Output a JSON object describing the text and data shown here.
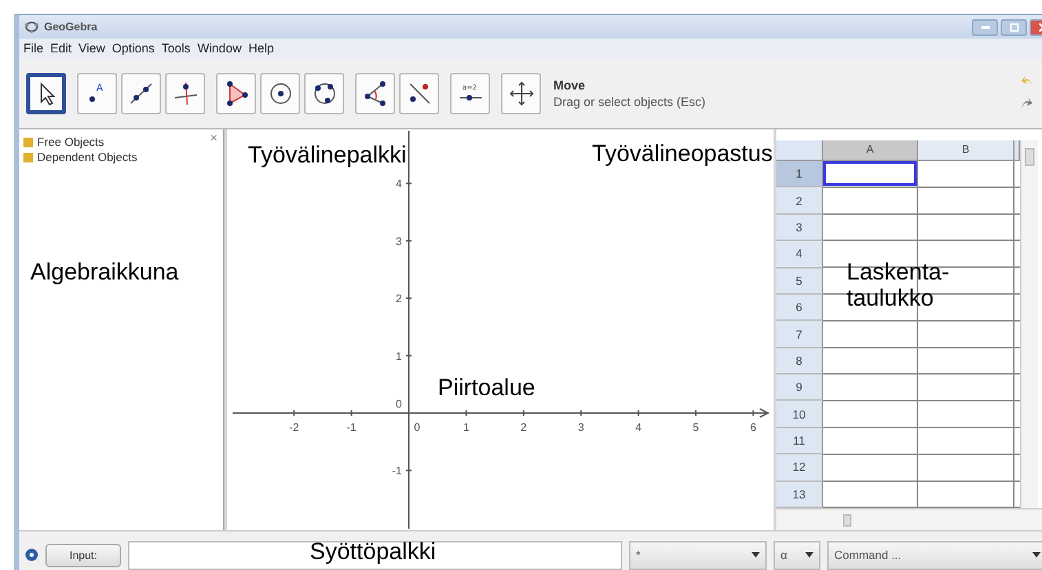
{
  "window": {
    "title": "GeoGebra"
  },
  "menu": [
    "File",
    "Edit",
    "View",
    "Options",
    "Tools",
    "Window",
    "Help"
  ],
  "toolbar": {
    "tools": [
      {
        "kind": "select",
        "selected": true
      },
      {
        "kind": "point",
        "selected": false,
        "icon_text": "A"
      },
      {
        "kind": "line",
        "selected": false
      },
      {
        "kind": "perpendicular",
        "selected": false
      },
      {
        "kind": "polygon",
        "selected": false
      },
      {
        "kind": "circle",
        "selected": false
      },
      {
        "kind": "conic",
        "selected": false
      },
      {
        "kind": "angle",
        "selected": false
      },
      {
        "kind": "reflect",
        "selected": false
      },
      {
        "kind": "slider",
        "selected": false,
        "icon_text": "a=2"
      },
      {
        "kind": "move-view",
        "selected": false
      }
    ],
    "tool_name": "Move",
    "tool_help": "Drag or select objects (Esc)"
  },
  "algebra_view": {
    "close": "×",
    "items": [
      "Free Objects",
      "Dependent Objects"
    ]
  },
  "graphics_view": {
    "x_ticks": [
      "-2",
      "-1",
      "0",
      "1",
      "2",
      "3",
      "4",
      "5",
      "6"
    ],
    "y_ticks": [
      "4",
      "3",
      "2",
      "1",
      "0",
      "-1"
    ]
  },
  "spreadsheet": {
    "columns": [
      {
        "label": "A",
        "selected": true
      },
      {
        "label": "B",
        "selected": false
      }
    ],
    "rows": [
      {
        "label": "1",
        "selected": true
      },
      {
        "label": "2",
        "selected": false
      },
      {
        "label": "3",
        "selected": false
      },
      {
        "label": "4",
        "selected": false
      },
      {
        "label": "5",
        "selected": false
      },
      {
        "label": "6",
        "selected": false
      },
      {
        "label": "7",
        "selected": false
      },
      {
        "label": "8",
        "selected": false
      },
      {
        "label": "9",
        "selected": false
      },
      {
        "label": "10",
        "selected": false
      },
      {
        "label": "11",
        "selected": false
      },
      {
        "label": "12",
        "selected": false
      },
      {
        "label": "13",
        "selected": false
      }
    ]
  },
  "input_bar": {
    "button": "Input:",
    "symbol_menu": "*",
    "greek_menu": "α",
    "command_menu": "Command ..."
  },
  "annotations": [
    {
      "lines": [
        "Työvälinepalkki"
      ]
    },
    {
      "lines": [
        "Työvälineopastus"
      ]
    },
    {
      "lines": [
        "Algebraikkuna"
      ]
    },
    {
      "lines": [
        "Laskenta-",
        "taulukko"
      ]
    },
    {
      "lines": [
        "Piirtoalue"
      ]
    },
    {
      "lines": [
        "Syöttöpalkki"
      ]
    }
  ]
}
